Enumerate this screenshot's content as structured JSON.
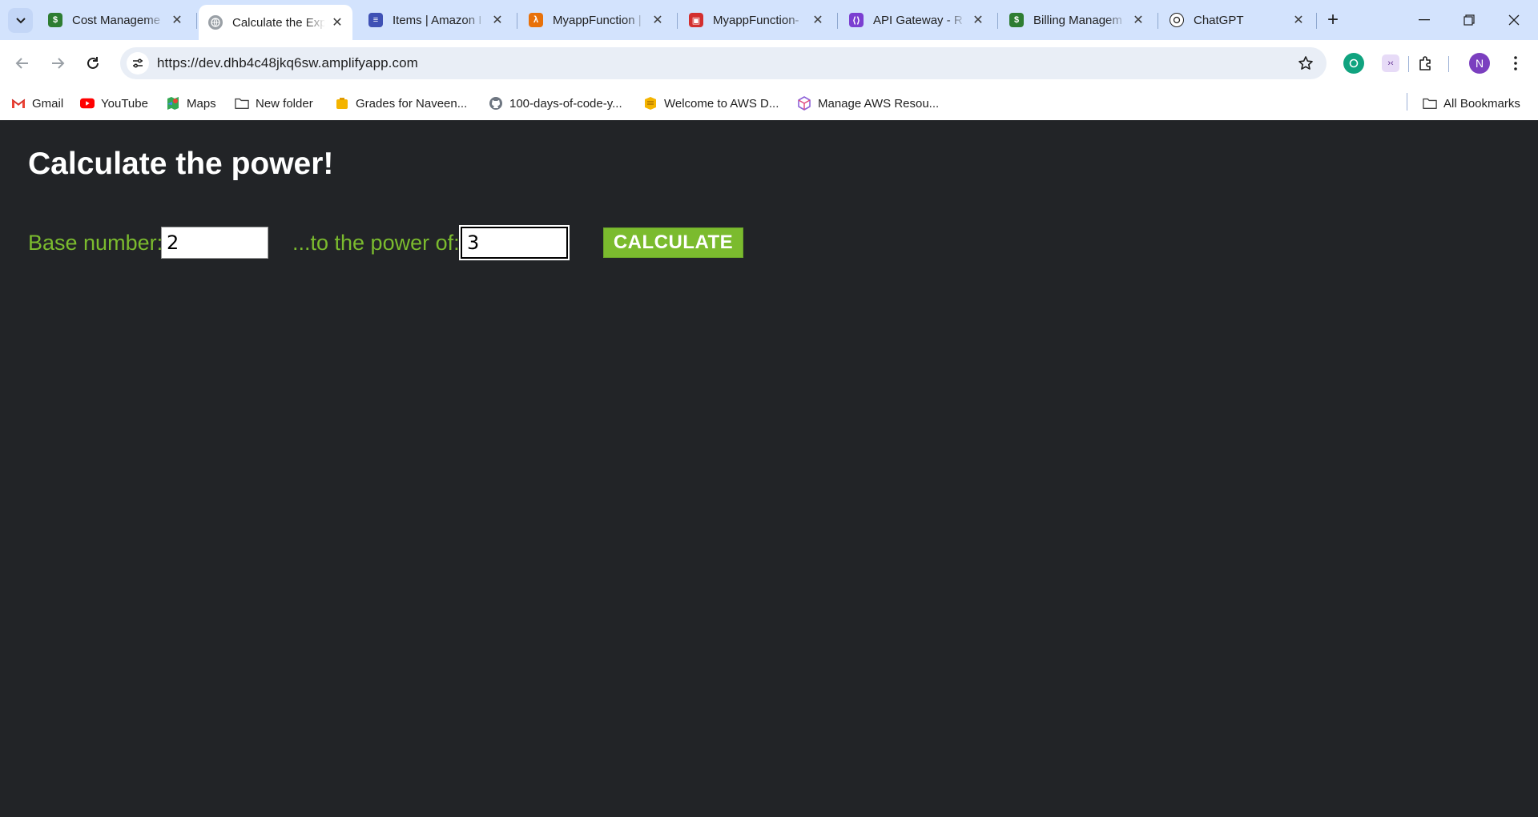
{
  "browser": {
    "tabs": [
      {
        "title": "Cost Manageme",
        "favicon_color": "#2e7d32",
        "favicon": "billing-icon",
        "active": false
      },
      {
        "title": "Calculate the Exp",
        "favicon_color": "#9aa0a6",
        "favicon": "globe-icon",
        "active": true
      },
      {
        "title": "Items | Amazon I",
        "favicon_color": "#3f51b5",
        "favicon": "dynamodb-icon",
        "active": false
      },
      {
        "title": "MyappFunction |",
        "favicon_color": "#e8710a",
        "favicon": "lambda-icon",
        "active": false
      },
      {
        "title": "MyappFunction-",
        "favicon_color": "#d32f2f",
        "favicon": "iam-icon",
        "active": false
      },
      {
        "title": "API Gateway - R",
        "favicon_color": "#7b3fd1",
        "favicon": "api-gateway-icon",
        "active": false
      },
      {
        "title": "Billing Managem",
        "favicon_color": "#2e7d32",
        "favicon": "billing-icon",
        "active": false
      },
      {
        "title": "ChatGPT",
        "favicon_color": "#1f1f1f",
        "favicon": "chatgpt-icon",
        "active": false
      }
    ],
    "url": "https://dev.dhb4c48jkq6sw.amplifyapp.com",
    "profile_initial": "N",
    "bookmarks": [
      {
        "label": "Gmail",
        "icon": "gmail-icon"
      },
      {
        "label": "YouTube",
        "icon": "youtube-icon"
      },
      {
        "label": "Maps",
        "icon": "maps-icon"
      },
      {
        "label": "New folder",
        "icon": "folder-icon"
      },
      {
        "label": "Grades for Naveen...",
        "icon": "grades-icon"
      },
      {
        "label": "100-days-of-code-y...",
        "icon": "github-icon"
      },
      {
        "label": "Welcome to AWS D...",
        "icon": "aws-icon"
      },
      {
        "label": "Manage AWS Resou...",
        "icon": "aws-cube-icon"
      }
    ],
    "all_bookmarks_label": "All Bookmarks"
  },
  "page": {
    "title": "Calculate the power!",
    "base_label": "Base number:",
    "base_value": "2",
    "exponent_label": "...to the power of:",
    "exponent_value": "3",
    "calculate_label": "CALCULATE",
    "accent_color": "#7bbb2e",
    "background_color": "#222427"
  }
}
